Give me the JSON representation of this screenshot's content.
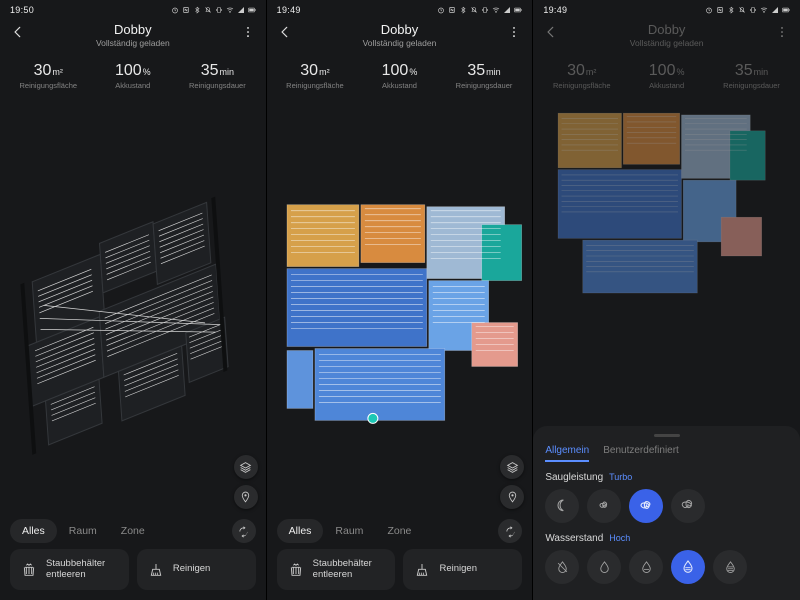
{
  "screens": [
    {
      "statusbar": {
        "time": "19:50"
      }
    },
    {
      "statusbar": {
        "time": "19:49"
      }
    },
    {
      "statusbar": {
        "time": "19:49"
      }
    }
  ],
  "header": {
    "title": "Dobby",
    "subtitle": "Vollständig geladen"
  },
  "stats": {
    "area": {
      "value": "30",
      "unit": "m²",
      "label": "Reinigungsfläche"
    },
    "battery": {
      "value": "100",
      "unit": "%",
      "label": "Akkustand"
    },
    "duration": {
      "value": "35",
      "unit": "min",
      "label": "Reinigungsdauer"
    }
  },
  "segments": {
    "all": "Alles",
    "room": "Raum",
    "zone": "Zone"
  },
  "actions": {
    "empty": "Staubbehälter entleeren",
    "clean": "Reinigen"
  },
  "sheet": {
    "tab_general": "Allgemein",
    "tab_custom": "Benutzerdefiniert",
    "suction_label": "Saugleistung",
    "suction_value": "Turbo",
    "water_label": "Wasserstand",
    "water_value": "Hoch"
  }
}
